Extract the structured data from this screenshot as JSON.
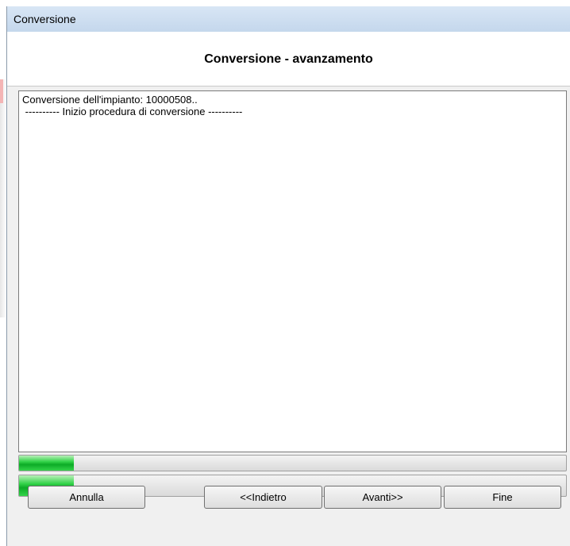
{
  "window": {
    "title": "Conversione"
  },
  "header": {
    "heading": "Conversione - avanzamento"
  },
  "log": {
    "lines": [
      "Conversione dell'impianto: 10000508..",
      " ---------- Inizio procedura di conversione ----------"
    ]
  },
  "progress": {
    "current_fraction": 0.1,
    "overall_fraction": 0.1
  },
  "buttons": {
    "cancel": "Annulla",
    "back": "<<Indietro",
    "next": "Avanti>>",
    "finish": "Fine"
  },
  "colors": {
    "progress_fill": "#1cc234",
    "title_bar": "#c4d7ec"
  }
}
